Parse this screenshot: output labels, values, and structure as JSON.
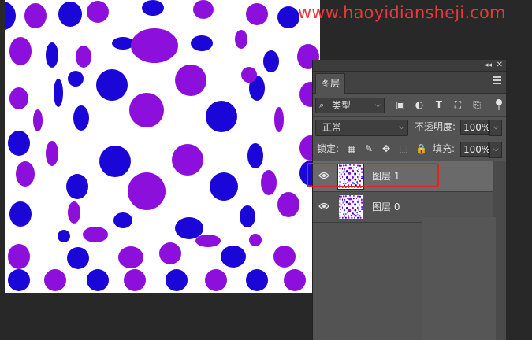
{
  "watermark": "www.haoyidiansheji.com",
  "canvas": {
    "background": "#ffffff",
    "dot_colors": [
      "#1a06d6",
      "#8d0fdc"
    ]
  },
  "panel": {
    "tab_label": "图层",
    "filter": {
      "kind_label": "类型",
      "icons": [
        "image-icon",
        "adjustment-icon",
        "type-icon",
        "shape-icon",
        "smart-object-icon"
      ]
    },
    "blend_mode": "正常",
    "opacity_label": "不透明度:",
    "opacity_value": "100%",
    "lock_label": "锁定:",
    "lock_icons": [
      "lock-pixels-icon",
      "lock-brush-icon",
      "lock-move-icon",
      "lock-artboard-icon",
      "lock-all-icon"
    ],
    "fill_label": "填充:",
    "fill_value": "100%",
    "layers": [
      {
        "name": "图层 1",
        "visible": true,
        "selected": true
      },
      {
        "name": "图层 0",
        "visible": true,
        "selected": false
      }
    ]
  },
  "colors": {
    "panel_bg": "#535353",
    "selected_row": "#6a6a6a",
    "highlight": "#e02424",
    "watermark": "#e8383b"
  }
}
